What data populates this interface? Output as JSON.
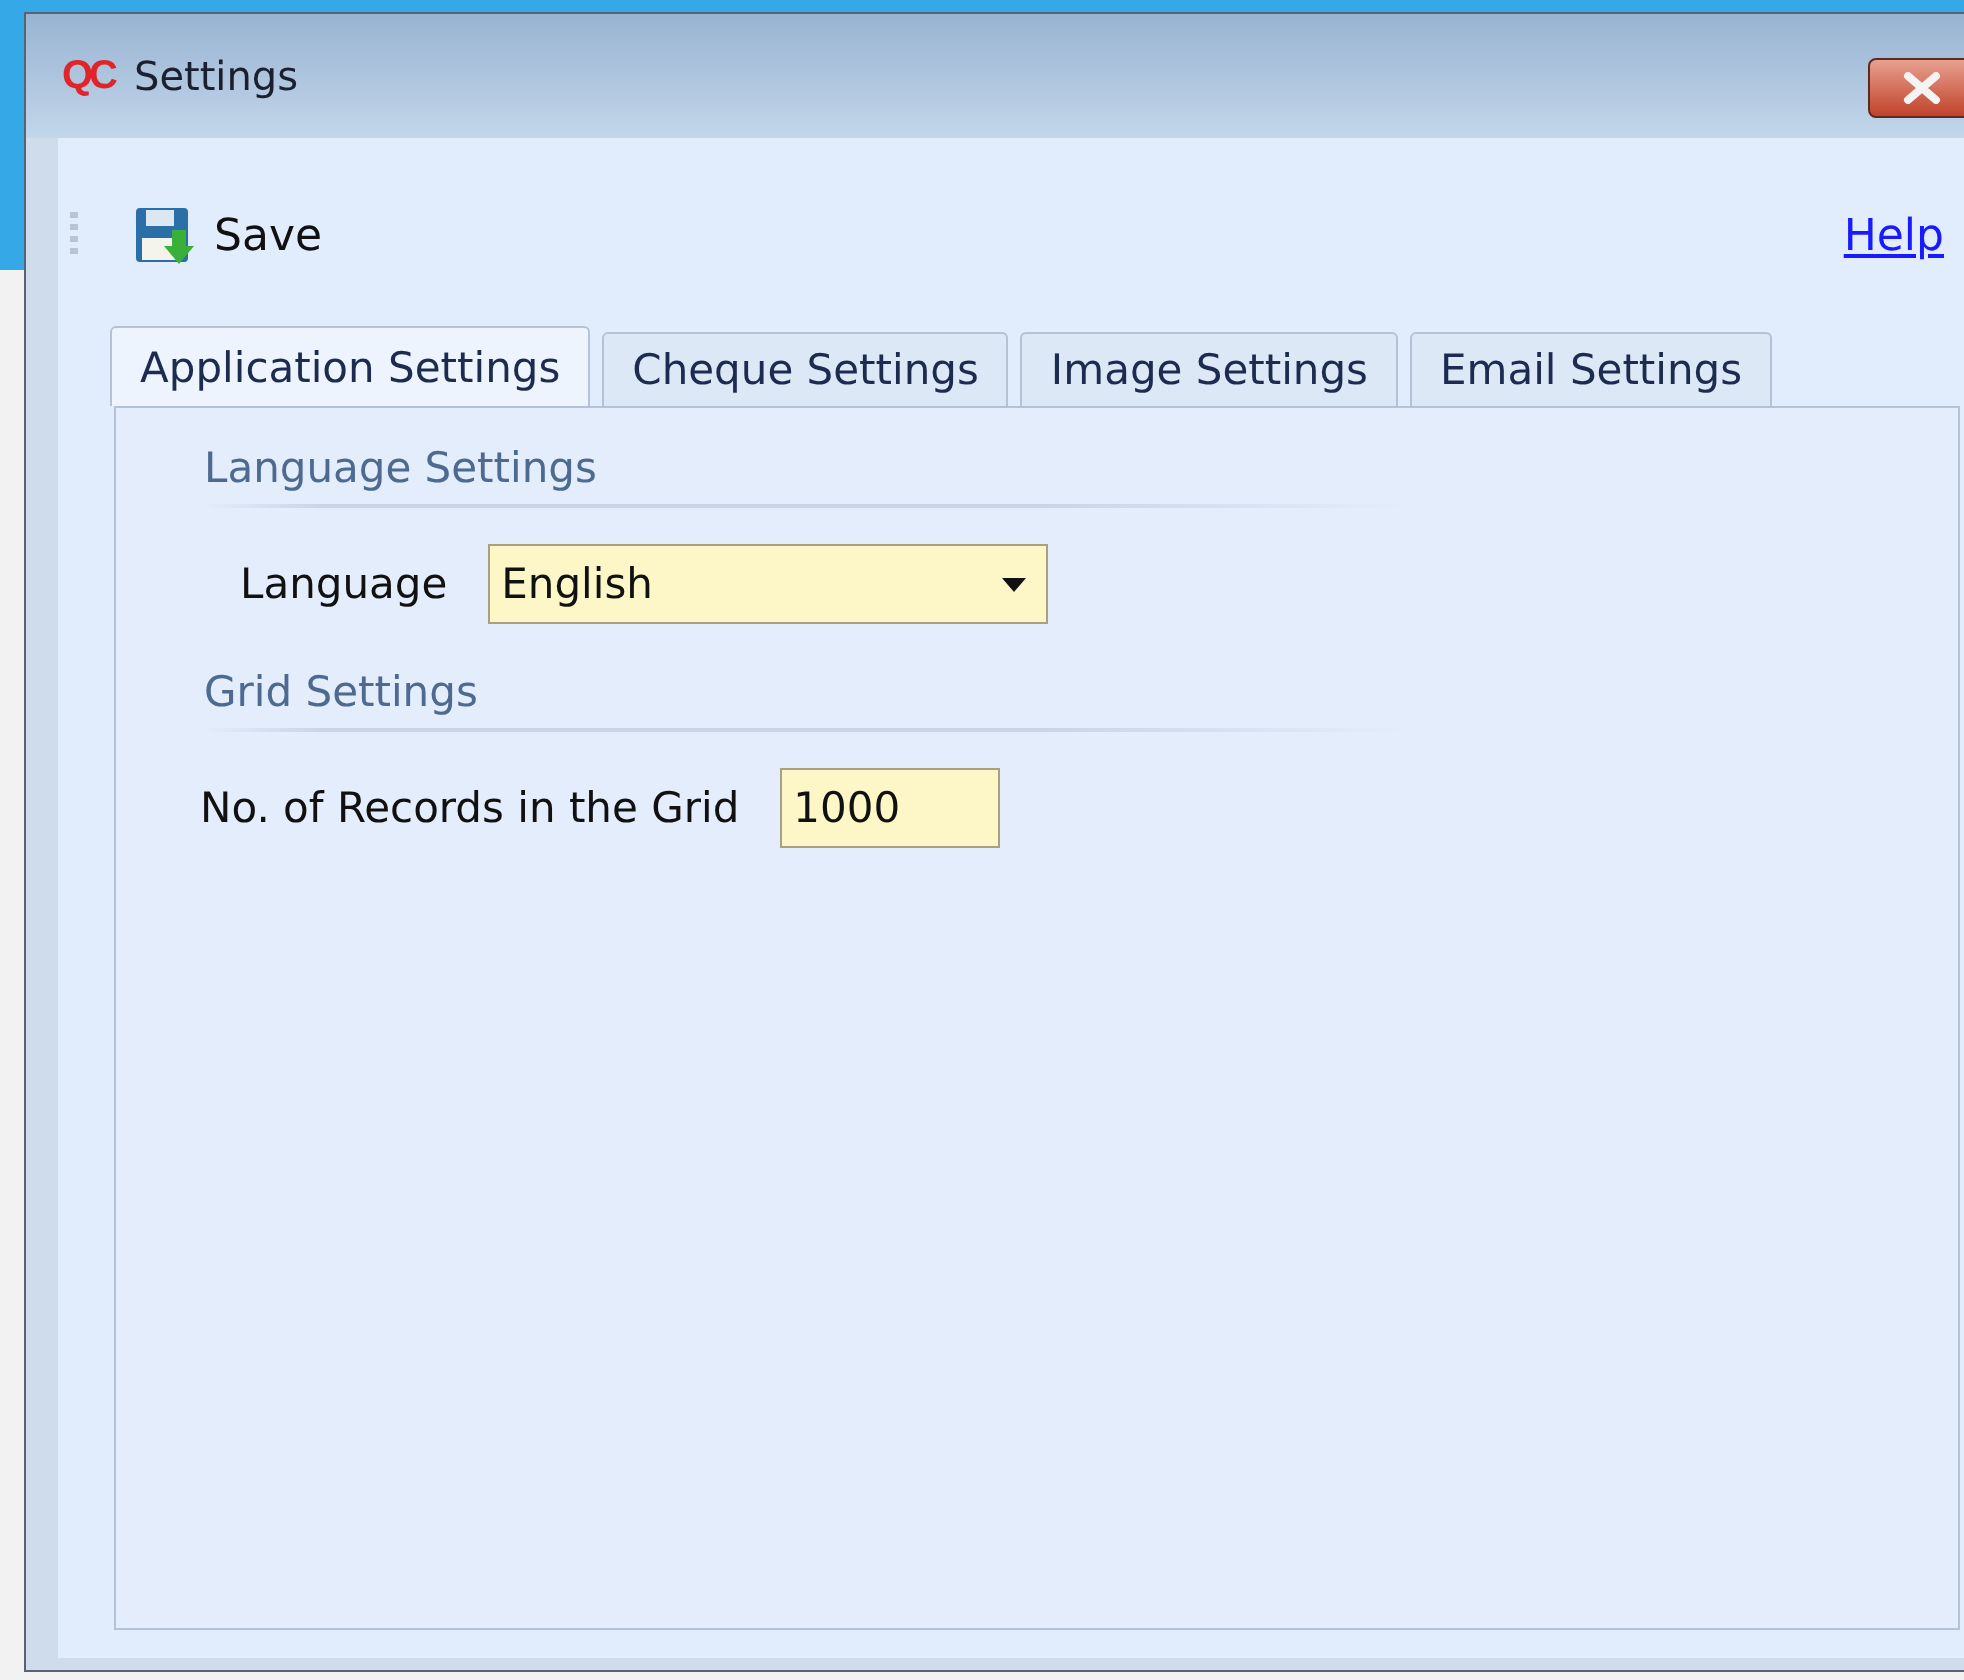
{
  "window": {
    "logo": "QC",
    "title": "Settings"
  },
  "toolbar": {
    "save": "Save",
    "help": "Help"
  },
  "tabs": [
    {
      "label": "Application Settings",
      "selected": true
    },
    {
      "label": "Cheque Settings",
      "selected": false
    },
    {
      "label": "Image Settings",
      "selected": false
    },
    {
      "label": "Email Settings",
      "selected": false
    }
  ],
  "sections": [
    {
      "title": "Language Settings",
      "fields": [
        {
          "kind": "dropdown",
          "label": "Language",
          "value": "English"
        }
      ]
    },
    {
      "title": "Grid Settings",
      "fields": [
        {
          "kind": "text",
          "label": "No. of Records in the Grid",
          "value": "1000"
        }
      ]
    }
  ]
}
